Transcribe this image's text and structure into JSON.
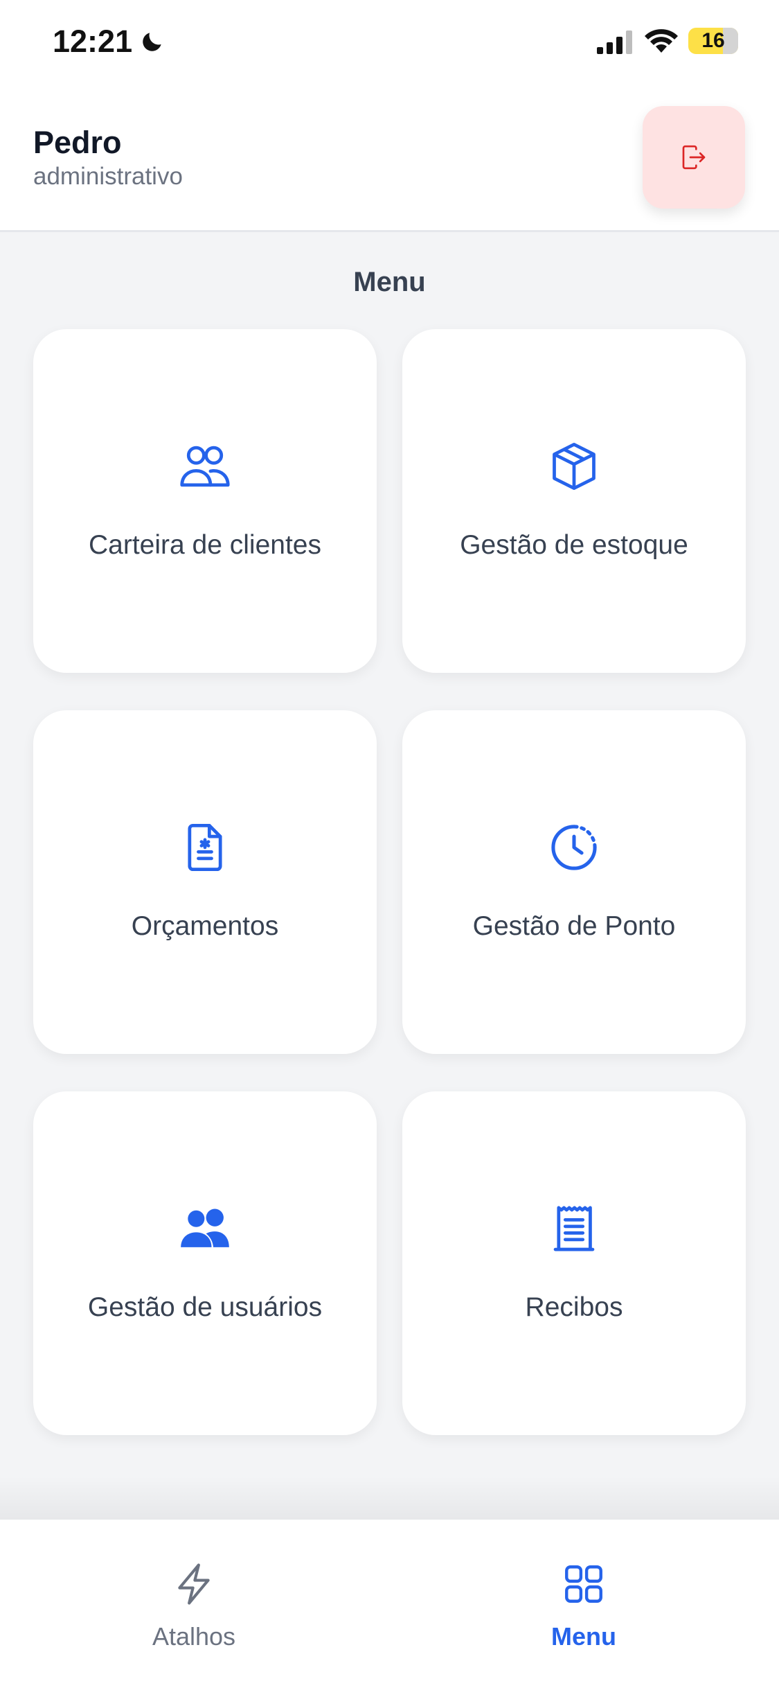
{
  "status_bar": {
    "time": "12:21",
    "battery": "16"
  },
  "header": {
    "user_name": "Pedro",
    "user_role": "administrativo"
  },
  "menu": {
    "title": "Menu",
    "tiles": [
      {
        "label": "Carteira de clientes",
        "icon": "users-outline-icon"
      },
      {
        "label": "Gestão de estoque",
        "icon": "cube-icon"
      },
      {
        "label": "Orçamentos",
        "icon": "document-icon"
      },
      {
        "label": "Gestão de Ponto",
        "icon": "clock-icon"
      },
      {
        "label": "Gestão de usuários",
        "icon": "users-solid-icon"
      },
      {
        "label": "Recibos",
        "icon": "receipt-icon"
      }
    ]
  },
  "bottom_nav": {
    "items": [
      {
        "label": "Atalhos",
        "icon": "lightning-icon",
        "active": false
      },
      {
        "label": "Menu",
        "icon": "grid-icon",
        "active": true
      }
    ]
  },
  "colors": {
    "accent": "#2563eb",
    "logout_bg": "#fee2e2",
    "logout_icon": "#dc2626"
  }
}
